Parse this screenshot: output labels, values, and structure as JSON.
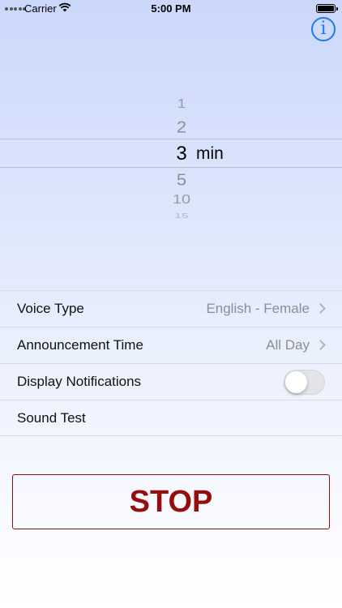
{
  "status_bar": {
    "carrier": "Carrier",
    "time": "5:00 PM"
  },
  "info_button": {
    "icon": "info-icon",
    "glyph": "i",
    "color": "#1a7cf0"
  },
  "picker": {
    "items_above": [
      "1",
      "2"
    ],
    "selected_value": "3",
    "unit": "min",
    "items_below": [
      "5",
      "10",
      "15"
    ]
  },
  "settings": {
    "voice_type": {
      "label": "Voice Type",
      "value": "English - Female"
    },
    "announcement_time": {
      "label": "Announcement Time",
      "value": "All Day"
    },
    "display_notifications": {
      "label": "Display Notifications",
      "enabled": false
    },
    "sound_test": {
      "label": "Sound Test"
    }
  },
  "stop_button": {
    "label": "STOP",
    "color": "#950d0d"
  }
}
